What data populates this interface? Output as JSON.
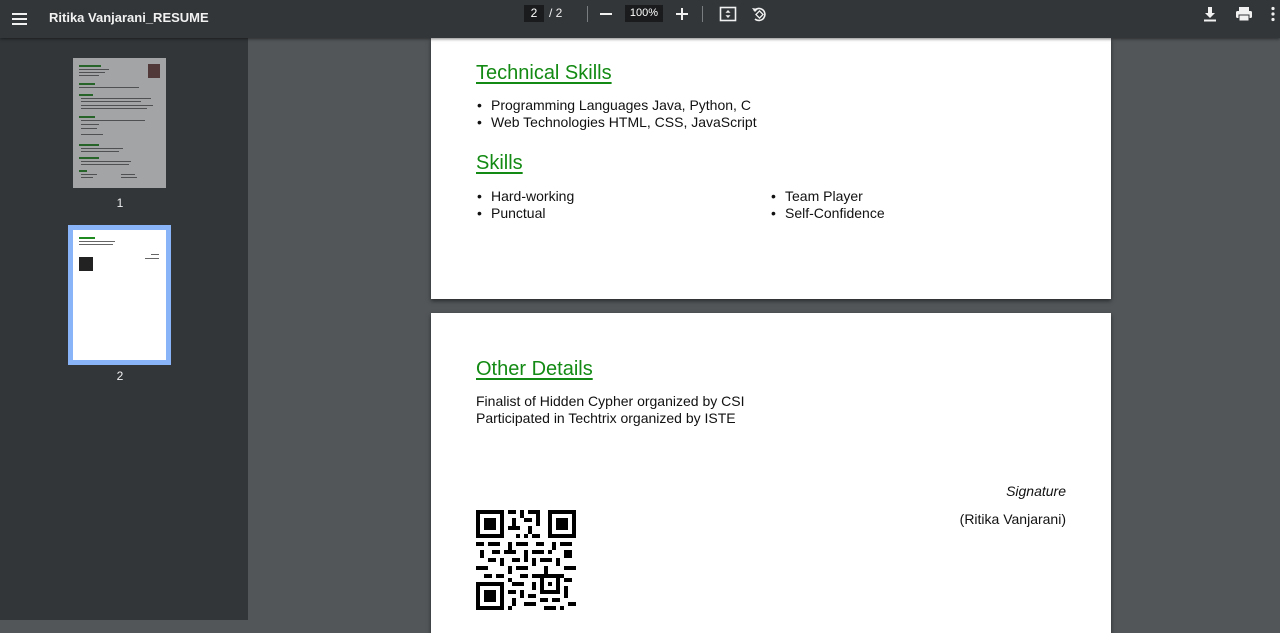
{
  "toolbar": {
    "title": "Ritika Vanjarani_RESUME",
    "current_page": "2",
    "page_total": "/ 2",
    "zoom": "100%",
    "icons": [
      "menu-icon",
      "zoom-out-icon",
      "zoom-in-icon",
      "fit-page-icon",
      "rotate-icon",
      "download-icon",
      "print-icon",
      "more-icon"
    ]
  },
  "sidebar": {
    "thumbnails": [
      {
        "label": "1",
        "selected": false
      },
      {
        "label": "2",
        "selected": true
      }
    ]
  },
  "page_a": {
    "technical_skills": {
      "title": "Technical Skills",
      "items": [
        "Programming Languages Java, Python, C",
        "Web Technologies HTML, CSS, JavaScript"
      ]
    },
    "skills": {
      "title": "Skills",
      "left": [
        "Hard-working",
        "Punctual"
      ],
      "right": [
        "Team Player",
        "Self-Confidence"
      ]
    }
  },
  "page_b": {
    "other_details": {
      "title": "Other Details",
      "lines": [
        "Finalist of Hidden Cypher organized by CSI",
        "Participated in Techtrix organized by ISTE"
      ]
    },
    "signature_label": "Signature",
    "signature_name": "(Ritika Vanjarani)"
  },
  "colors": {
    "toolbar_bg": "#323639",
    "viewer_bg": "#525659",
    "heading_green": "#138a13",
    "selection_blue": "#8ab4f8"
  }
}
